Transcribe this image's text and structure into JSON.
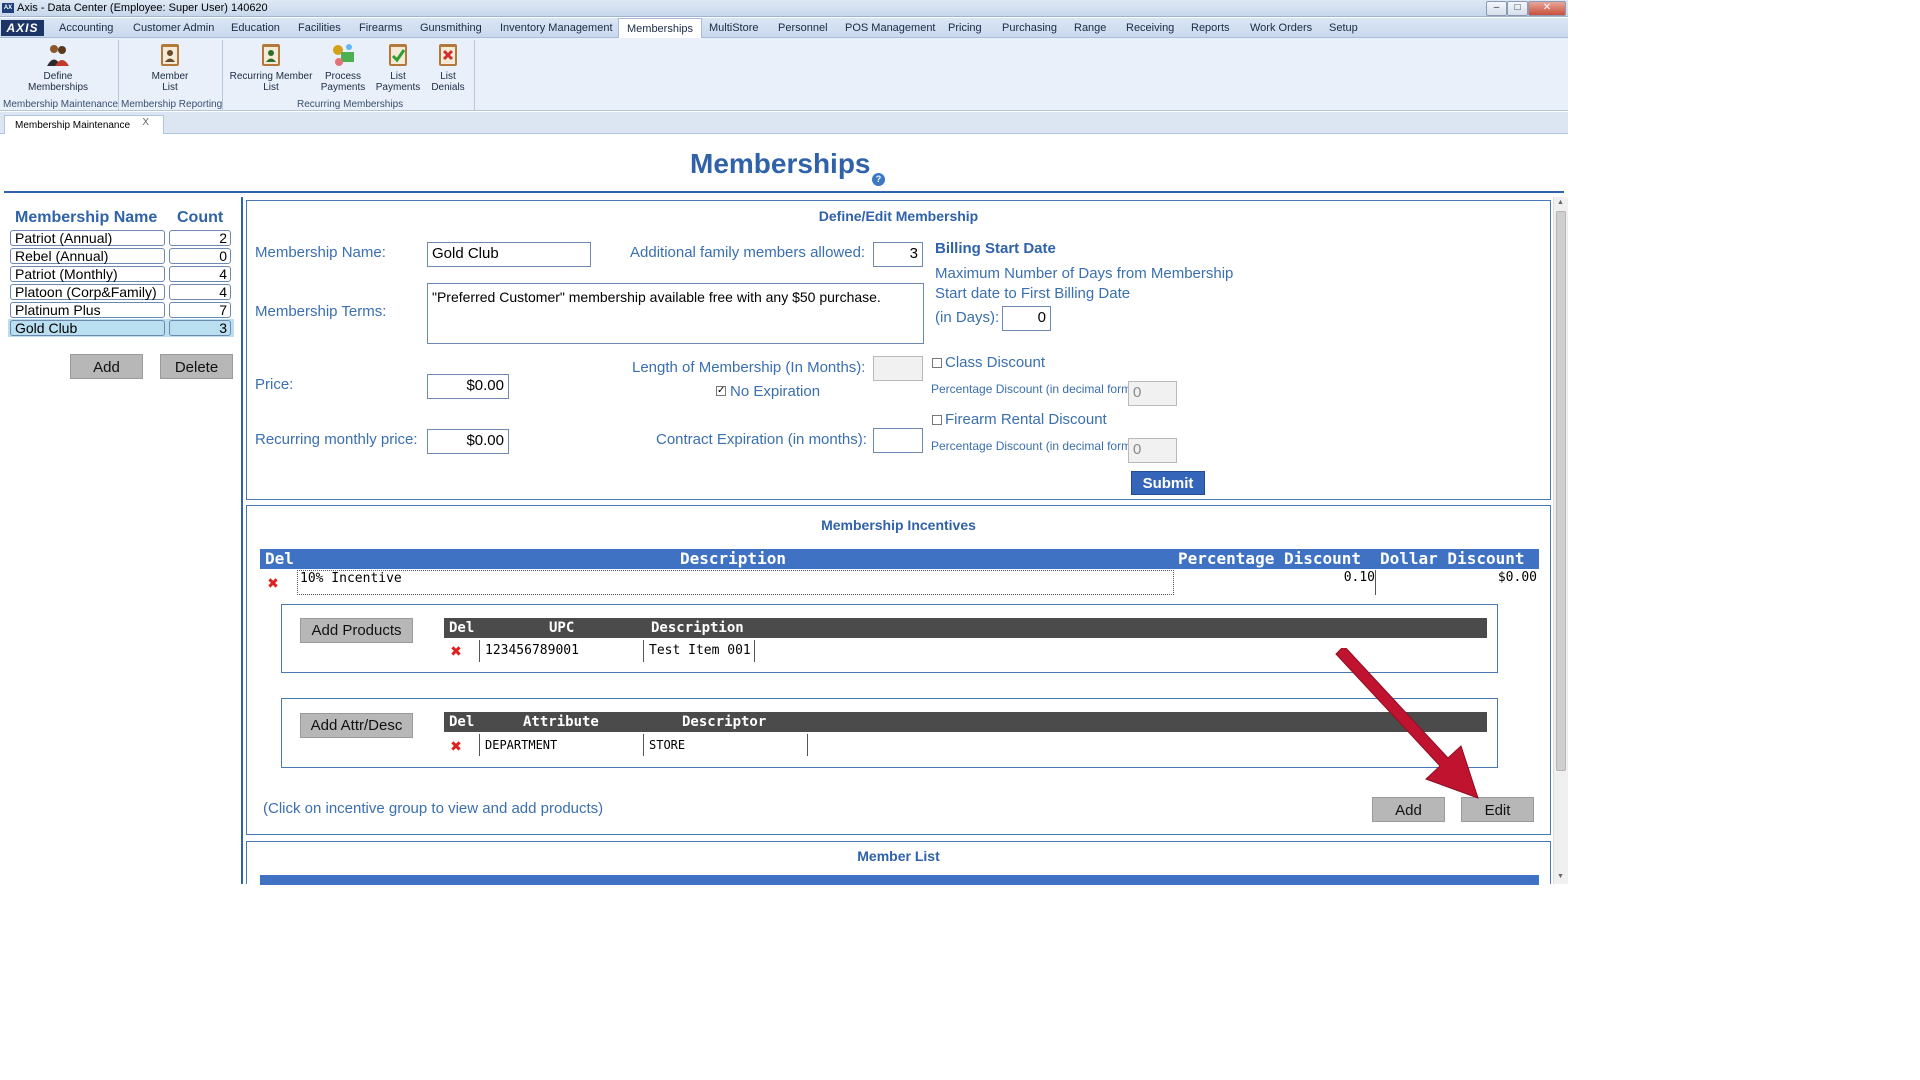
{
  "window": {
    "title": "Axis - Data Center  (Employee: Super User) 140620"
  },
  "menu": {
    "logo": "AXIS",
    "items": [
      "Accounting",
      "Customer Admin",
      "Education",
      "Facilities",
      "Firearms",
      "Gunsmithing",
      "Inventory Management",
      "Memberships",
      "MultiStore",
      "Personnel",
      "POS Management",
      "Pricing",
      "Purchasing",
      "Range",
      "Receiving",
      "Reports",
      "Work Orders",
      "Setup"
    ],
    "active": "Memberships"
  },
  "ribbon": {
    "buttons": [
      {
        "l1": "Define",
        "l2": "Memberships"
      },
      {
        "l1": "Member",
        "l2": "List"
      },
      {
        "l1": "Recurring Member",
        "l2": "List"
      },
      {
        "l1": "Process",
        "l2": "Payments"
      },
      {
        "l1": "List",
        "l2": "Payments"
      },
      {
        "l1": "List",
        "l2": "Denials"
      }
    ],
    "groups": [
      "Membership Maintenance",
      "Membership Reporting",
      "Recurring Memberships"
    ]
  },
  "doc_tab": {
    "label": "Membership Maintenance",
    "close": "X"
  },
  "page": {
    "title": "Memberships",
    "help": "?"
  },
  "membership_list": {
    "header_name": "Membership Name",
    "header_count": "Count",
    "rows": [
      {
        "name": "Patriot (Annual)",
        "count": "2"
      },
      {
        "name": "Rebel (Annual)",
        "count": "0"
      },
      {
        "name": "Patriot (Monthly)",
        "count": "4"
      },
      {
        "name": "Platoon (Corp&Family)",
        "count": "4"
      },
      {
        "name": "Platinum Plus",
        "count": "7"
      },
      {
        "name": "Gold Club",
        "count": "3"
      }
    ],
    "selected_index": 5,
    "add_label": "Add",
    "delete_label": "Delete"
  },
  "define_edit": {
    "title": "Define/Edit Membership",
    "name_label": "Membership Name:",
    "name_value": "Gold Club",
    "family_label": "Additional family members allowed:",
    "family_value": "3",
    "terms_label": "Membership Terms:",
    "terms_value": "\"Preferred Customer\" membership available free with any $50 purchase.",
    "price_label": "Price:",
    "price_value": "$0.00",
    "recurring_label": "Recurring monthly price:",
    "recurring_value": "$0.00",
    "length_label": "Length of Membership (In Months):",
    "length_value": "",
    "no_expiration_label": "No Expiration",
    "no_expiration_checked": true,
    "contract_label": "Contract Expiration (in months):",
    "contract_value": "",
    "billing_title": "Billing Start Date",
    "billing_desc1": "Maximum Number of Days from Membership",
    "billing_desc2": "Start date to First Billing Date",
    "billing_days_label": "(in Days):",
    "billing_days_value": "0",
    "class_discount_label": "Class Discount",
    "class_pct_label": "Percentage Discount (in decimal form)",
    "class_pct_value": "0",
    "firearm_discount_label": "Firearm Rental Discount",
    "firearm_pct_label": "Percentage Discount (in decimal form)",
    "firearm_pct_value": "0",
    "submit_label": "Submit"
  },
  "incentives": {
    "title": "Membership Incentives",
    "headers": {
      "del": "Del",
      "description": "Description",
      "pct": "Percentage Discount",
      "dollar": "Dollar Discount"
    },
    "rows": [
      {
        "description": "10% Incentive",
        "pct": "0.10",
        "dollar": "$0.00"
      }
    ],
    "products": {
      "add_label": "Add Products",
      "headers": {
        "del": "Del",
        "upc": "UPC",
        "description": "Description"
      },
      "rows": [
        {
          "upc": "123456789001",
          "description": "Test Item 001"
        }
      ]
    },
    "attributes": {
      "add_label": "Add Attr/Desc",
      "headers": {
        "del": "Del",
        "attribute": "Attribute",
        "descriptor": "Descriptor"
      },
      "rows": [
        {
          "attribute": "DEPARTMENT",
          "descriptor": "STORE"
        }
      ]
    },
    "hint": "(Click on incentive group to view and add products)",
    "add_label": "Add",
    "edit_label": "Edit"
  },
  "member_list": {
    "title": "Member List"
  },
  "colors": {
    "accent": "#2f62a8",
    "table_header": "#3f72c2",
    "annotation_arrow": "#c0132f"
  }
}
